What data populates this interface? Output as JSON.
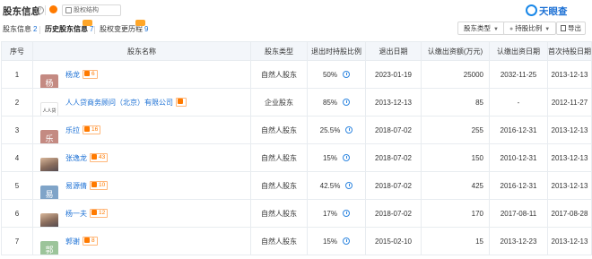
{
  "header": {
    "title": "股东信息",
    "help_glyph": "?",
    "structure_label": "股权结构",
    "logo_text": "天眼查"
  },
  "tabs": [
    {
      "label": "股东信息",
      "count": "2",
      "active": false
    },
    {
      "label": "历史股东信息",
      "count": "7",
      "active": true
    },
    {
      "label": "股权变更历程",
      "count": "9",
      "active": false
    }
  ],
  "controls": {
    "type_filter": "股东类型",
    "ratio_filter": "持股比例",
    "export_label": "导出"
  },
  "table": {
    "headers": [
      "序号",
      "股东名称",
      "股东类型",
      "退出时持股比例",
      "退出日期",
      "认缴出资额(万元)",
      "认缴出资日期",
      "首次持股日期"
    ],
    "rows": [
      {
        "no": "1",
        "avatar": "杨",
        "avatar_color": "#c48a82",
        "name": "杨龙",
        "badge": "6",
        "type": "自然人股东",
        "ratio": "50%",
        "exit": "2023-01-19",
        "amount": "25000",
        "sub_date": "2032-11-25",
        "first": "2013-12-13"
      },
      {
        "no": "2",
        "avatar": "人人贷",
        "avatar_color": "logo",
        "name": "人人贷商务顾问（北京）有限公司",
        "badge": "",
        "type": "企业股东",
        "ratio": "85%",
        "exit": "2013-12-13",
        "amount": "85",
        "sub_date": "-",
        "first": "2012-11-27"
      },
      {
        "no": "3",
        "avatar": "乐",
        "avatar_color": "#c48a82",
        "name": "乐拉",
        "badge": "16",
        "type": "自然人股东",
        "ratio": "25.5%",
        "exit": "2018-07-02",
        "amount": "255",
        "sub_date": "2016-12-31",
        "first": "2013-12-13"
      },
      {
        "no": "4",
        "avatar": "",
        "avatar_color": "photo",
        "name": "张逸龙",
        "badge": "43",
        "type": "自然人股东",
        "ratio": "15%",
        "exit": "2018-07-02",
        "amount": "150",
        "sub_date": "2010-12-31",
        "first": "2013-12-13"
      },
      {
        "no": "5",
        "avatar": "易",
        "avatar_color": "#7fa4c8",
        "name": "易源倩",
        "badge": "10",
        "type": "自然人股东",
        "ratio": "42.5%",
        "exit": "2018-07-02",
        "amount": "425",
        "sub_date": "2016-12-31",
        "first": "2013-12-13"
      },
      {
        "no": "6",
        "avatar": "",
        "avatar_color": "photo",
        "name": "杨一夫",
        "badge": "12",
        "type": "自然人股东",
        "ratio": "17%",
        "exit": "2018-07-02",
        "amount": "170",
        "sub_date": "2017-08-11",
        "first": "2017-08-28"
      },
      {
        "no": "7",
        "avatar": "郭",
        "avatar_color": "#9cc49a",
        "name": "郭谢",
        "badge": "8",
        "type": "自然人股东",
        "ratio": "15%",
        "exit": "2015-02-10",
        "amount": "15",
        "sub_date": "2013-12-23",
        "first": "2013-12-13"
      }
    ]
  }
}
